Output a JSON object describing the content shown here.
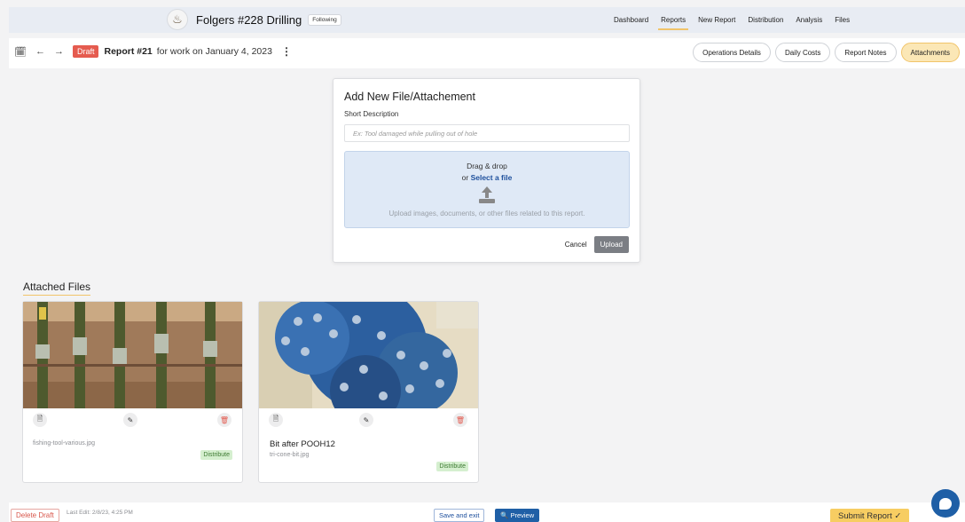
{
  "header": {
    "title": "Folgers #228 Drilling",
    "following_label": "Following",
    "nav": [
      "Dashboard",
      "Reports",
      "New Report",
      "Distribution",
      "Analysis",
      "Files"
    ],
    "active_nav": "Reports"
  },
  "toolbar": {
    "draft_label": "Draft",
    "report_number": "Report #21",
    "report_date": "for work on January 4, 2023",
    "tabs": [
      "Operations Details",
      "Daily Costs",
      "Report Notes",
      "Attachments"
    ],
    "active_tab": "Attachments"
  },
  "add_file": {
    "title": "Add New File/Attachement",
    "desc_label": "Short Description",
    "desc_placeholder": "Ex: Tool damaged while pulling out of hole",
    "drag_label": "Drag & drop",
    "or_label": "or ",
    "select_label": "Select a file",
    "hint": "Upload images, documents, or other files related to this report.",
    "cancel_label": "Cancel",
    "upload_label": "Upload"
  },
  "attached": {
    "title": "Attached Files",
    "files": [
      {
        "description": "",
        "filename": "fishing-tool-various.jpg",
        "distribute_label": "Distribute"
      },
      {
        "description": "Bit after POOH12",
        "filename": "tri-cone-bit.jpg",
        "distribute_label": "Distribute"
      }
    ]
  },
  "footer": {
    "delete_label": "Delete Draft",
    "last_edit": "Last Edit: 2/8/23, 4:25 PM",
    "save_exit_label": "Save and exit",
    "preview_label": "Preview",
    "submit_label": "Submit Report"
  },
  "colors": {
    "accent": "#f1c46a",
    "draft": "#e55b4f",
    "primary": "#1f5fa6",
    "distribute_bg": "#d5efcf"
  }
}
